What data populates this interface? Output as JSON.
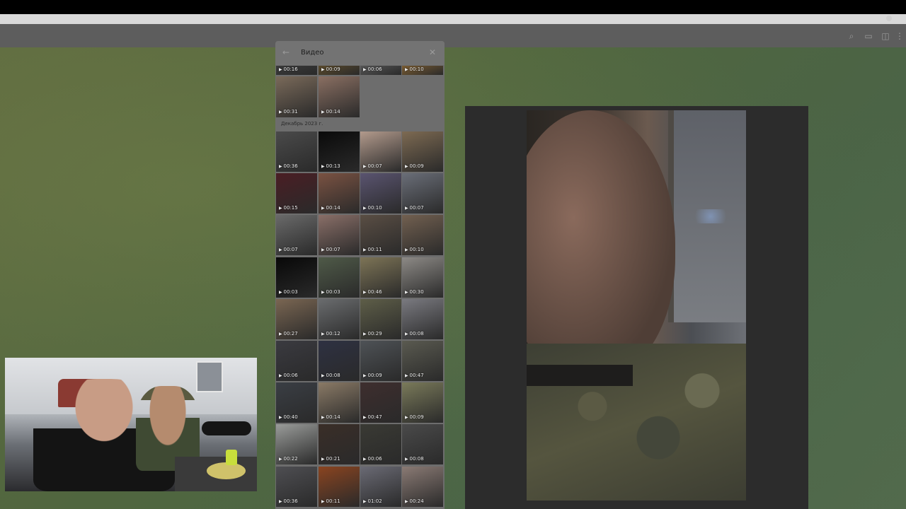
{
  "panel": {
    "title": "Видео",
    "month_label": "Декабрь 2023 г."
  },
  "top_strip": [
    {
      "duration": "00:16",
      "color": "#3a3a3a"
    },
    {
      "duration": "00:09",
      "color": "#5a4a2c"
    },
    {
      "duration": "00:06",
      "color": "#565656"
    },
    {
      "duration": "00:10",
      "color": "#7a5c32"
    }
  ],
  "november_rest": [
    {
      "duration": "00:31",
      "color": "#7a6a5a"
    },
    {
      "duration": "00:14",
      "color": "#8a6f62"
    }
  ],
  "december_videos": [
    {
      "duration": "00:36",
      "color": "#4a4a4a"
    },
    {
      "duration": "00:13",
      "color": "#0a0a0a"
    },
    {
      "duration": "00:07",
      "color": "#b29a8c"
    },
    {
      "duration": "00:09",
      "color": "#7d6a52"
    },
    {
      "duration": "00:15",
      "color": "#4a1e24"
    },
    {
      "duration": "00:14",
      "color": "#7a5242"
    },
    {
      "duration": "00:10",
      "color": "#5a5470"
    },
    {
      "duration": "00:07",
      "color": "#6a6e78"
    },
    {
      "duration": "00:07",
      "color": "#6a6a6a"
    },
    {
      "duration": "00:07",
      "color": "#8a6f68"
    },
    {
      "duration": "00:11",
      "color": "#5a4e44"
    },
    {
      "duration": "00:10",
      "color": "#726050"
    },
    {
      "duration": "00:03",
      "color": "#080808"
    },
    {
      "duration": "00:03",
      "color": "#4f5a48"
    },
    {
      "duration": "00:46",
      "color": "#7d7456"
    },
    {
      "duration": "00:30",
      "color": "#8d8a86"
    },
    {
      "duration": "00:27",
      "color": "#7a6652"
    },
    {
      "duration": "00:12",
      "color": "#6a6c6e"
    },
    {
      "duration": "00:29",
      "color": "#5e5e48"
    },
    {
      "duration": "00:08",
      "color": "#7a7a80"
    },
    {
      "duration": "00:06",
      "color": "#3a3a40"
    },
    {
      "duration": "00:08",
      "color": "#2e3142"
    },
    {
      "duration": "00:09",
      "color": "#4e5256"
    },
    {
      "duration": "00:47",
      "color": "#5a5a50"
    },
    {
      "duration": "00:40",
      "color": "#3a3e44"
    },
    {
      "duration": "00:14",
      "color": "#8a7a66"
    },
    {
      "duration": "00:47",
      "color": "#3e2e2e"
    },
    {
      "duration": "00:09",
      "color": "#7a7a5a"
    },
    {
      "duration": "00:22",
      "color": "#9a9c9a"
    },
    {
      "duration": "00:21",
      "color": "#3a2e28"
    },
    {
      "duration": "00:06",
      "color": "#3a3a34"
    },
    {
      "duration": "00:08",
      "color": "#4a4a4a"
    },
    {
      "duration": "00:36",
      "color": "#4e4e52"
    },
    {
      "duration": "00:11",
      "color": "#8a4420"
    },
    {
      "duration": "01:02",
      "color": "#6a6a74"
    },
    {
      "duration": "00:24",
      "color": "#8a7a74"
    }
  ]
}
